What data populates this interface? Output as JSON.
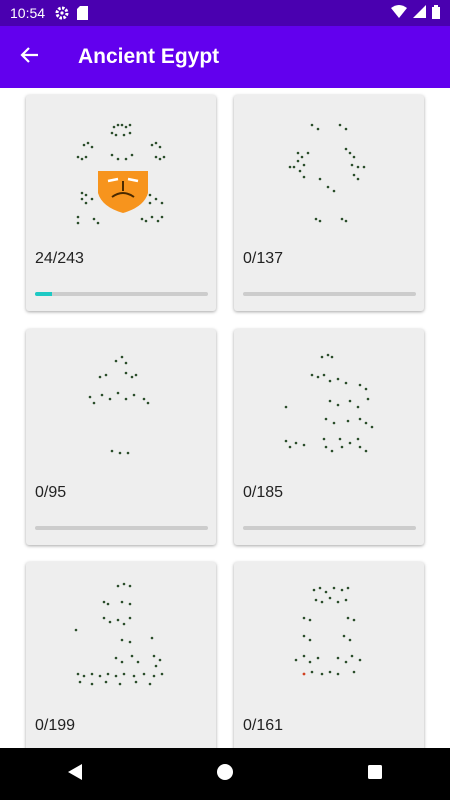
{
  "status_bar": {
    "time": "10:54",
    "icons": [
      "gear-icon",
      "sd-card-icon",
      "wifi-icon",
      "signal-icon",
      "battery-icon"
    ]
  },
  "app_bar": {
    "title": "Ancient Egypt",
    "back_icon": "arrow-back-icon",
    "color": "#6200ee",
    "status_color": "#4a00b0"
  },
  "levels": [
    {
      "count": "24/243",
      "progress": 0.099
    },
    {
      "count": "0/137",
      "progress": 0
    },
    {
      "count": "0/95",
      "progress": 0
    },
    {
      "count": "0/185",
      "progress": 0
    },
    {
      "count": "0/199",
      "progress": 0
    },
    {
      "count": "0/161",
      "progress": 0
    }
  ],
  "accent_color": "#1ec9c4",
  "nav_bar": {
    "icons": [
      "back-triangle-icon",
      "home-circle-icon",
      "recents-square-icon"
    ]
  }
}
